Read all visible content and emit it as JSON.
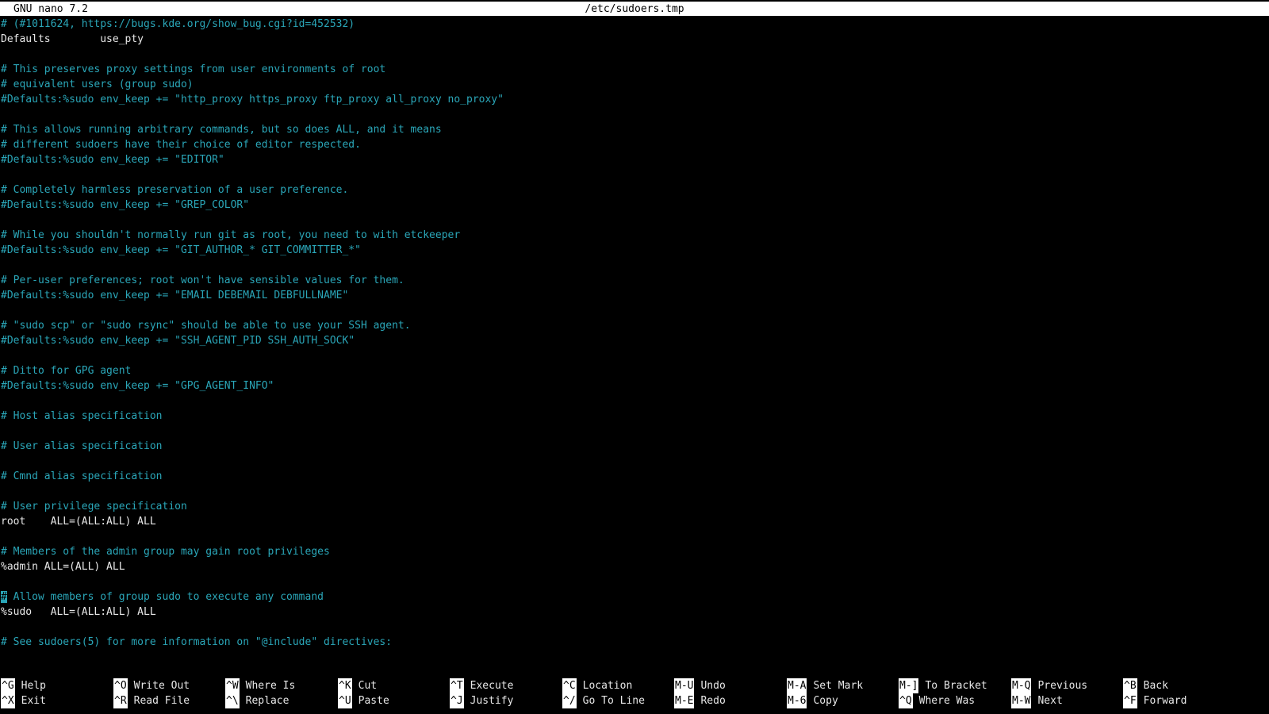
{
  "title_bar": {
    "app": "GNU nano 7.2",
    "file": "/etc/sudoers.tmp"
  },
  "lines": [
    {
      "t": "# (#1011624, https://bugs.kde.org/show_bug.cgi?id=452532)",
      "c": "comment"
    },
    {
      "t": "Defaults        use_pty",
      "c": "code"
    },
    {
      "t": "",
      "c": "code"
    },
    {
      "t": "# This preserves proxy settings from user environments of root",
      "c": "comment"
    },
    {
      "t": "# equivalent users (group sudo)",
      "c": "comment"
    },
    {
      "t": "#Defaults:%sudo env_keep += \"http_proxy https_proxy ftp_proxy all_proxy no_proxy\"",
      "c": "comment"
    },
    {
      "t": "",
      "c": "code"
    },
    {
      "t": "# This allows running arbitrary commands, but so does ALL, and it means",
      "c": "comment"
    },
    {
      "t": "# different sudoers have their choice of editor respected.",
      "c": "comment"
    },
    {
      "t": "#Defaults:%sudo env_keep += \"EDITOR\"",
      "c": "comment"
    },
    {
      "t": "",
      "c": "code"
    },
    {
      "t": "# Completely harmless preservation of a user preference.",
      "c": "comment"
    },
    {
      "t": "#Defaults:%sudo env_keep += \"GREP_COLOR\"",
      "c": "comment"
    },
    {
      "t": "",
      "c": "code"
    },
    {
      "t": "# While you shouldn't normally run git as root, you need to with etckeeper",
      "c": "comment"
    },
    {
      "t": "#Defaults:%sudo env_keep += \"GIT_AUTHOR_* GIT_COMMITTER_*\"",
      "c": "comment"
    },
    {
      "t": "",
      "c": "code"
    },
    {
      "t": "# Per-user preferences; root won't have sensible values for them.",
      "c": "comment"
    },
    {
      "t": "#Defaults:%sudo env_keep += \"EMAIL DEBEMAIL DEBFULLNAME\"",
      "c": "comment"
    },
    {
      "t": "",
      "c": "code"
    },
    {
      "t": "# \"sudo scp\" or \"sudo rsync\" should be able to use your SSH agent.",
      "c": "comment"
    },
    {
      "t": "#Defaults:%sudo env_keep += \"SSH_AGENT_PID SSH_AUTH_SOCK\"",
      "c": "comment"
    },
    {
      "t": "",
      "c": "code"
    },
    {
      "t": "# Ditto for GPG agent",
      "c": "comment"
    },
    {
      "t": "#Defaults:%sudo env_keep += \"GPG_AGENT_INFO\"",
      "c": "comment"
    },
    {
      "t": "",
      "c": "code"
    },
    {
      "t": "# Host alias specification",
      "c": "comment"
    },
    {
      "t": "",
      "c": "code"
    },
    {
      "t": "# User alias specification",
      "c": "comment"
    },
    {
      "t": "",
      "c": "code"
    },
    {
      "t": "# Cmnd alias specification",
      "c": "comment"
    },
    {
      "t": "",
      "c": "code"
    },
    {
      "t": "# User privilege specification",
      "c": "comment"
    },
    {
      "t": "root    ALL=(ALL:ALL) ALL",
      "c": "code"
    },
    {
      "t": "",
      "c": "code"
    },
    {
      "t": "# Members of the admin group may gain root privileges",
      "c": "comment"
    },
    {
      "t": "%admin ALL=(ALL) ALL",
      "c": "code"
    },
    {
      "t": "",
      "c": "code"
    },
    {
      "t": "# Allow members of group sudo to execute any command",
      "c": "comment",
      "cursor": true
    },
    {
      "t": "%sudo   ALL=(ALL:ALL) ALL",
      "c": "code"
    },
    {
      "t": "",
      "c": "code"
    },
    {
      "t": "# See sudoers(5) for more information on \"@include\" directives:",
      "c": "comment"
    }
  ],
  "shortcuts": [
    [
      {
        "k": "^G",
        "l": "Help"
      },
      {
        "k": "^X",
        "l": "Exit"
      }
    ],
    [
      {
        "k": "^O",
        "l": "Write Out"
      },
      {
        "k": "^R",
        "l": "Read File"
      }
    ],
    [
      {
        "k": "^W",
        "l": "Where Is"
      },
      {
        "k": "^\\",
        "l": "Replace"
      }
    ],
    [
      {
        "k": "^K",
        "l": "Cut"
      },
      {
        "k": "^U",
        "l": "Paste"
      }
    ],
    [
      {
        "k": "^T",
        "l": "Execute"
      },
      {
        "k": "^J",
        "l": "Justify"
      }
    ],
    [
      {
        "k": "^C",
        "l": "Location"
      },
      {
        "k": "^/",
        "l": "Go To Line"
      }
    ],
    [
      {
        "k": "M-U",
        "l": "Undo"
      },
      {
        "k": "M-E",
        "l": "Redo"
      }
    ],
    [
      {
        "k": "M-A",
        "l": "Set Mark"
      },
      {
        "k": "M-6",
        "l": "Copy"
      }
    ],
    [
      {
        "k": "M-]",
        "l": "To Bracket"
      },
      {
        "k": "^Q",
        "l": "Where Was"
      }
    ],
    [
      {
        "k": "M-Q",
        "l": "Previous"
      },
      {
        "k": "M-W",
        "l": "Next"
      }
    ],
    [
      {
        "k": "^B",
        "l": "Back"
      },
      {
        "k": "^F",
        "l": "Forward"
      }
    ]
  ]
}
